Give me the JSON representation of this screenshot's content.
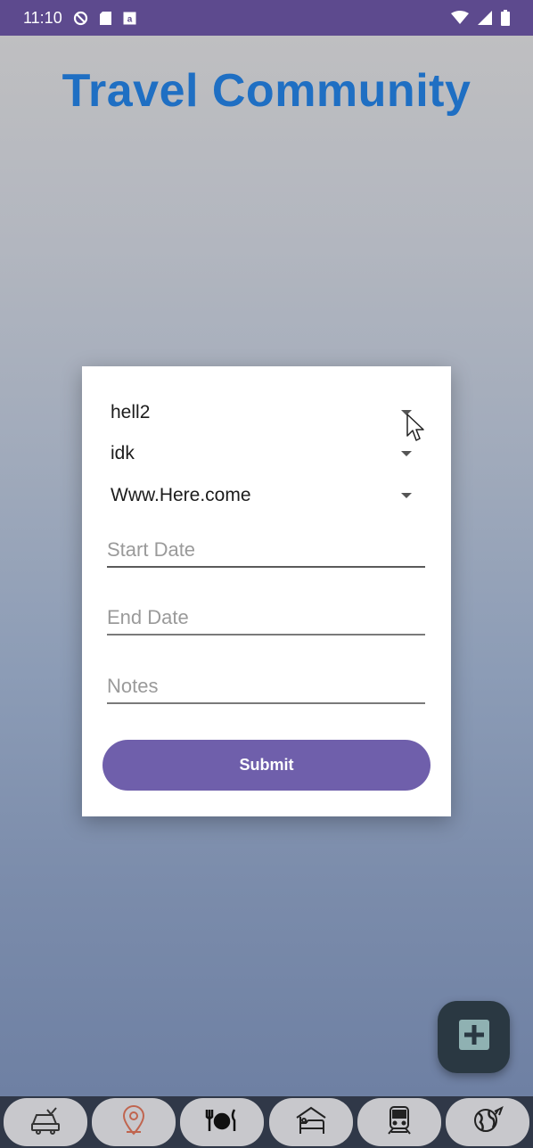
{
  "status_bar": {
    "time": "11:10",
    "icons": [
      "do-not-disturb-icon",
      "sd-card-icon",
      "notification-icon",
      "wifi-icon",
      "signal-icon",
      "battery-icon"
    ]
  },
  "app": {
    "title": "Travel Community"
  },
  "form": {
    "dropdowns": [
      {
        "value": "hell2"
      },
      {
        "value": "idk"
      },
      {
        "value": "Www.Here.come"
      }
    ],
    "start_date": {
      "placeholder": "Start Date",
      "value": ""
    },
    "end_date": {
      "placeholder": "End Date",
      "value": ""
    },
    "notes": {
      "placeholder": "Notes",
      "value": ""
    },
    "submit_label": "Submit"
  },
  "fab": {
    "icon": "add-icon"
  },
  "bottom_nav": {
    "items": [
      {
        "icon": "car-rental-icon"
      },
      {
        "icon": "location-pin-icon"
      },
      {
        "icon": "restaurant-icon"
      },
      {
        "icon": "hotel-icon"
      },
      {
        "icon": "train-icon"
      },
      {
        "icon": "globe-icon"
      }
    ]
  },
  "colors": {
    "status_bar": "#5d4a8e",
    "title": "#1f6fc3",
    "submit": "#6f5fab",
    "fab": "#2a3842",
    "nav_bar": "#303848"
  }
}
